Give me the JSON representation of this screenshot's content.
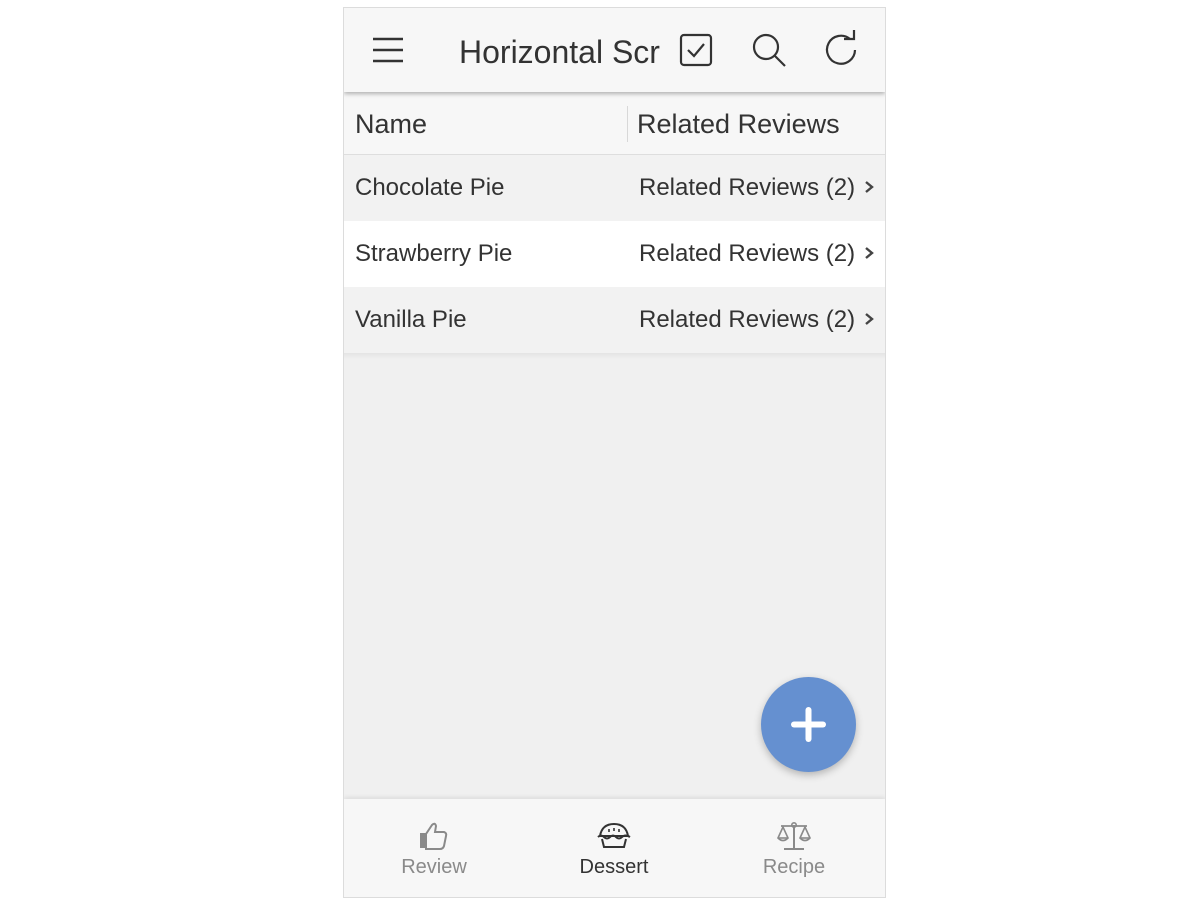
{
  "appbar": {
    "title": "Horizontal Scroll",
    "icons": [
      "menu-icon",
      "select-icon",
      "search-icon",
      "refresh-icon"
    ]
  },
  "table": {
    "columns": [
      "Name",
      "Related Reviews"
    ],
    "rows": [
      {
        "name": "Chocolate Pie",
        "related": "Related Reviews (2)"
      },
      {
        "name": "Strawberry Pie",
        "related": "Related Reviews (2)"
      },
      {
        "name": "Vanilla Pie",
        "related": "Related Reviews (2)"
      }
    ]
  },
  "fab": {
    "icon": "plus-icon",
    "color": "#6590d0"
  },
  "bottom_nav": {
    "items": [
      {
        "label": "Review",
        "icon": "thumbs-up-icon",
        "active": false
      },
      {
        "label": "Dessert",
        "icon": "pie-icon",
        "active": true
      },
      {
        "label": "Recipe",
        "icon": "scale-icon",
        "active": false
      }
    ]
  },
  "colors": {
    "text": "#333333",
    "inactive": "#8a8a8a",
    "accent": "#6590d0",
    "background": "#f0f0f0"
  }
}
